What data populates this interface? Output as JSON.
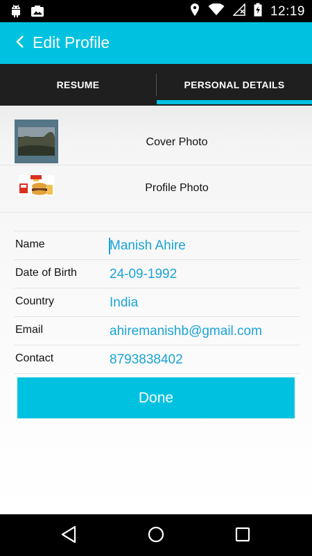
{
  "status_bar": {
    "time": "12:19",
    "left_icons": [
      "android-icon",
      "photo-notification-icon"
    ],
    "right_icons": [
      "location-icon",
      "wifi-icon",
      "no-signal-icon",
      "battery-charging-icon"
    ]
  },
  "app_bar": {
    "title": "Edit Profile",
    "back_icon": "chevron-left-icon",
    "color": "#00c2e0"
  },
  "tabs": [
    {
      "label": "RESUME",
      "selected": false
    },
    {
      "label": "PERSONAL DETAILS",
      "selected": true
    }
  ],
  "photos": {
    "cover_label": "Cover Photo",
    "profile_label": "Profile Photo"
  },
  "fields": [
    {
      "label": "Name",
      "value": "Manish Ahire"
    },
    {
      "label": "Date of Birth",
      "value": "24-09-1992"
    },
    {
      "label": "Country",
      "value": "India"
    },
    {
      "label": "Email",
      "value": "ahiremanishb@gmail.com"
    },
    {
      "label": "Contact",
      "value": "8793838402"
    }
  ],
  "done_button": {
    "label": "Done"
  },
  "nav_bar": {
    "buttons": [
      "back-triangle-icon",
      "home-circle-icon",
      "recents-square-icon"
    ]
  },
  "colors": {
    "accent": "#00c2e0",
    "value_text": "#1aa3d6",
    "tab_bar": "#1f1f1f"
  }
}
